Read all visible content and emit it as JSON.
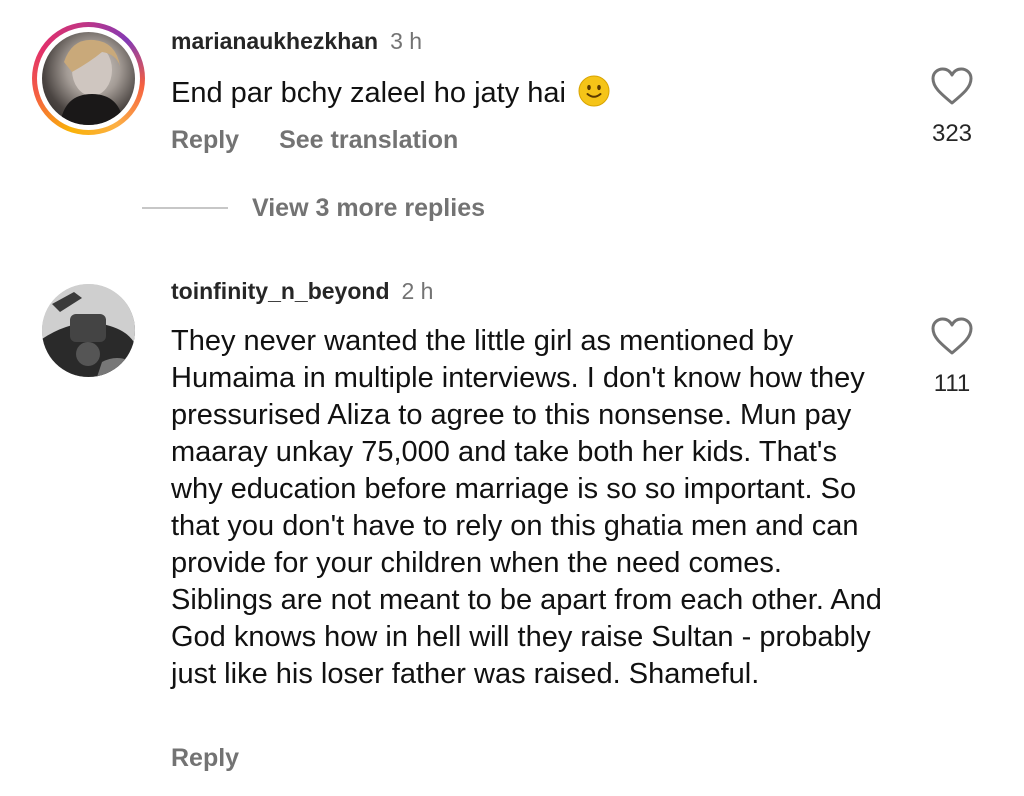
{
  "comments": [
    {
      "username": "marianaukhezkhan",
      "time": "3 h",
      "text": "End par bchy zaleel ho jaty hai",
      "emoji": "slightly-smiling-face",
      "reply_label": "Reply",
      "translate_label": "See translation",
      "likes": "323",
      "view_replies": "View 3 more replies"
    },
    {
      "username": "toinfinity_n_beyond",
      "time": "2 h",
      "text": "They never wanted the little girl as mentioned by Humaima in multiple interviews. I don't know how they pressurised Aliza to agree to this nonsense. Mun pay maaray unkay 75,000 and take both her kids. That's why education before marriage is so so important. So that you don't have to rely on this ghatia men and can provide for your children when the need comes. Siblings are not meant to be apart from each other. And God knows how in hell will they raise Sultan - probably just like his loser father was raised. Shameful.",
      "reply_label": "Reply",
      "likes": "111"
    }
  ],
  "colors": {
    "text": "#111111",
    "muted": "#737373",
    "divider": "#c7c7c7",
    "emoji": "#f5c418"
  },
  "icons": {
    "like": "heart-outline-icon",
    "emoji": "slightly-smiling-face"
  }
}
